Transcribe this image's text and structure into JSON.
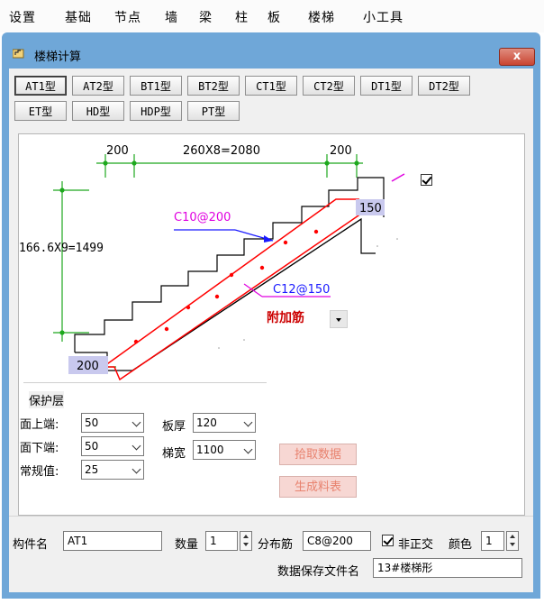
{
  "menu": [
    "设置",
    "基础",
    "节点",
    "墙",
    "梁",
    "柱",
    "板",
    "楼梯",
    "小工具"
  ],
  "window": {
    "title": "楼梯计算",
    "close_label": "x"
  },
  "type_buttons": [
    "AT1型",
    "AT2型",
    "BT1型",
    "BT2型",
    "CT1型",
    "CT2型",
    "DT1型",
    "DT2型",
    "ET型",
    "HD型",
    "HDP型",
    "PT型"
  ],
  "active_type": "AT1型",
  "diagram": {
    "dim_left": "200",
    "dim_middle": "260X8=2080",
    "dim_right": "200",
    "dim_height": "166.6X9=1499",
    "rebar_top": "C10@200",
    "rebar_bottom": "C12@150",
    "extra_rebar": "附加筋",
    "right_thickness": "150",
    "left_thickness": "200"
  },
  "protection": {
    "group_label": "保护层",
    "top_label": "面上端:",
    "top_value": "50",
    "bottom_label": "面下端:",
    "bottom_value": "50",
    "normal_label": "常规值:",
    "normal_value": "25"
  },
  "slab": {
    "thickness_label": "板厚",
    "thickness_value": "120",
    "width_label": "梯宽",
    "width_value": "1100"
  },
  "buttons": {
    "pick_data": "拾取数据",
    "generate": "生成料表"
  },
  "bottom": {
    "component_label": "构件名",
    "component_value": "AT1",
    "qty_label": "数量",
    "qty_value": "1",
    "dist_label": "分布筋",
    "dist_value": "C8@200",
    "non_orth_label": "非正交",
    "color_label": "颜色",
    "color_value": "1",
    "save_label": "数据保存文件名",
    "save_value": "13#楼梯形"
  },
  "colors": {
    "accent": "#6fa7d8",
    "rebar_red": "#ff0000",
    "dim_green": "#1ea81e",
    "magenta": "#e000e0",
    "blue": "#1a1aff",
    "label_bg": "#c9c9ee"
  }
}
